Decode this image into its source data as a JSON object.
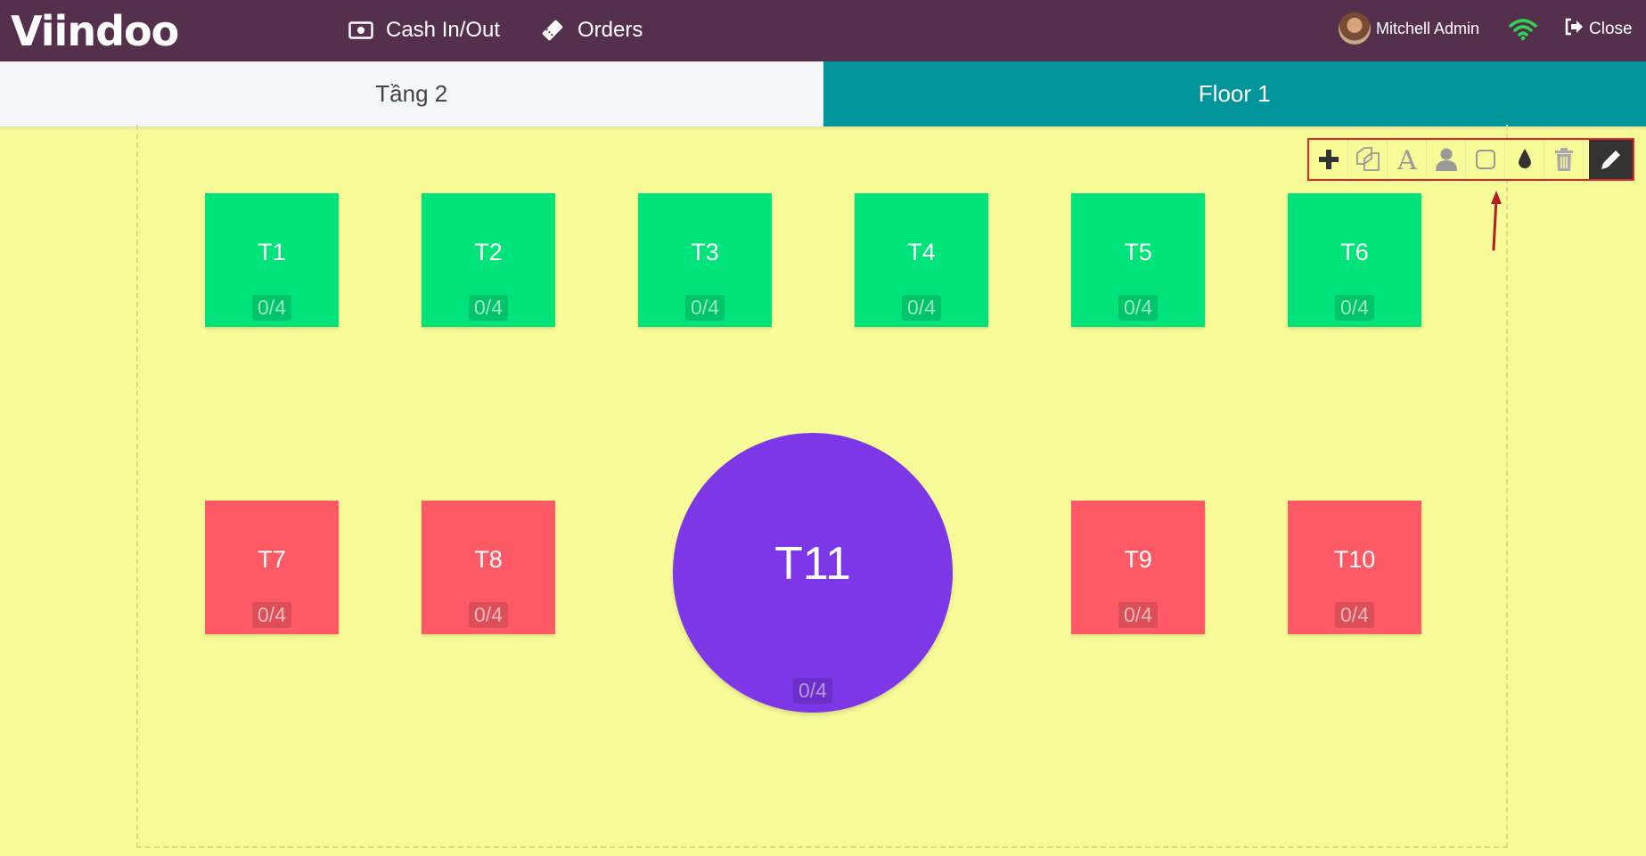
{
  "header": {
    "logo": "Viindoo",
    "cash_label": "Cash In/Out",
    "orders_label": "Orders",
    "user_name": "Mitchell Admin",
    "close_label": "Close"
  },
  "tabs": [
    {
      "label": "Tầng 2",
      "active": false
    },
    {
      "label": "Floor 1",
      "active": true
    }
  ],
  "tables": [
    {
      "name": "T1",
      "seats": "0/4",
      "color": "green"
    },
    {
      "name": "T2",
      "seats": "0/4",
      "color": "green"
    },
    {
      "name": "T3",
      "seats": "0/4",
      "color": "green"
    },
    {
      "name": "T4",
      "seats": "0/4",
      "color": "green"
    },
    {
      "name": "T5",
      "seats": "0/4",
      "color": "green"
    },
    {
      "name": "T6",
      "seats": "0/4",
      "color": "green"
    },
    {
      "name": "T7",
      "seats": "0/4",
      "color": "red"
    },
    {
      "name": "T8",
      "seats": "0/4",
      "color": "red"
    },
    {
      "name": "T11",
      "seats": "0/4",
      "color": "purple"
    },
    {
      "name": "T9",
      "seats": "0/4",
      "color": "red"
    },
    {
      "name": "T10",
      "seats": "0/4",
      "color": "red"
    }
  ],
  "toolbar": {
    "tools": [
      "plus-icon",
      "duplicate-icon",
      "text-icon",
      "user-icon",
      "shape-icon",
      "color-drop-icon",
      "trash-icon",
      "pencil-icon"
    ]
  },
  "colors": {
    "topbar": "#55304d",
    "floor_bg": "#f6fb98",
    "active_tab": "#01959b",
    "green_table": "#00e27a",
    "red_table": "#fd5a66",
    "purple_table": "#7d37e7",
    "highlight": "#e0262c"
  }
}
